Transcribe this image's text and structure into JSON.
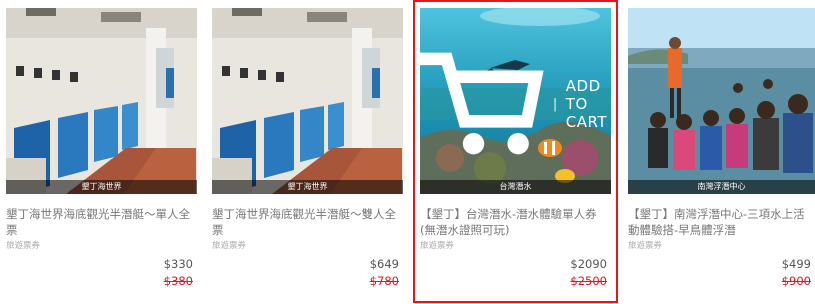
{
  "products": [
    {
      "image_caption": "墾丁海世界",
      "title": "墾丁海世界海底觀光半潛艇～單人全票",
      "subtitle": "旅遊票券",
      "price": "$330",
      "original_price": "$380",
      "highlighted": false
    },
    {
      "image_caption": "墾丁海世界",
      "title": "墾丁海世界海底觀光半潛艇～雙人全票",
      "subtitle": "旅遊票券",
      "price": "$649",
      "original_price": "$780",
      "highlighted": false
    },
    {
      "image_caption": "台灣潛水",
      "title": "【墾丁】台灣潛水-潛水體驗單人券(無潛水證照可玩)",
      "subtitle": "旅遊票券",
      "price": "$2090",
      "original_price": "$2500",
      "highlighted": true,
      "overlay": {
        "cart_icon": "cart-icon",
        "separator": "|",
        "label": "ADD TO CART"
      }
    },
    {
      "image_caption": "南灣浮潛中心",
      "title": "【墾丁】南灣浮潛中心-三項水上活動體驗搭-早鳥體浮潛",
      "subtitle": "旅遊票券",
      "price": "$499",
      "original_price": "$900",
      "highlighted": false
    }
  ],
  "colors": {
    "highlight_border": "#e0181d",
    "original_price": "#e0181d"
  }
}
